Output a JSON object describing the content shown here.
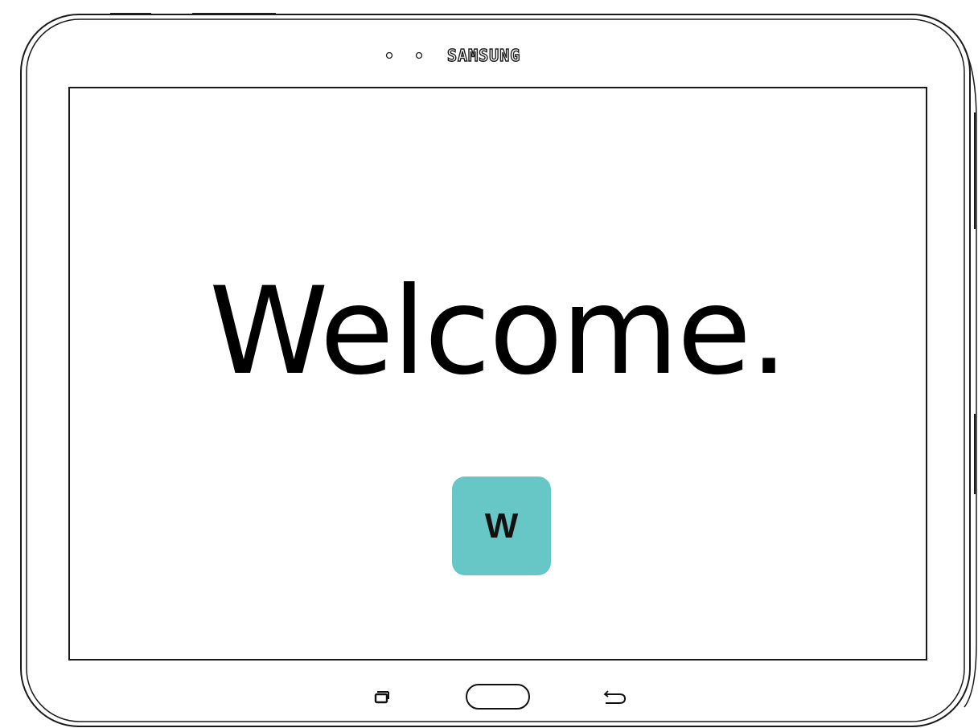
{
  "device": {
    "brand": "SAMSUNG"
  },
  "screen": {
    "title": "Welcome.",
    "app_tile": {
      "letter": "W",
      "color": "#66c7c6"
    }
  },
  "navigation": {
    "recent_apps_icon": "recent-apps-icon",
    "home_icon": "home-icon",
    "back_icon": "back-icon"
  }
}
